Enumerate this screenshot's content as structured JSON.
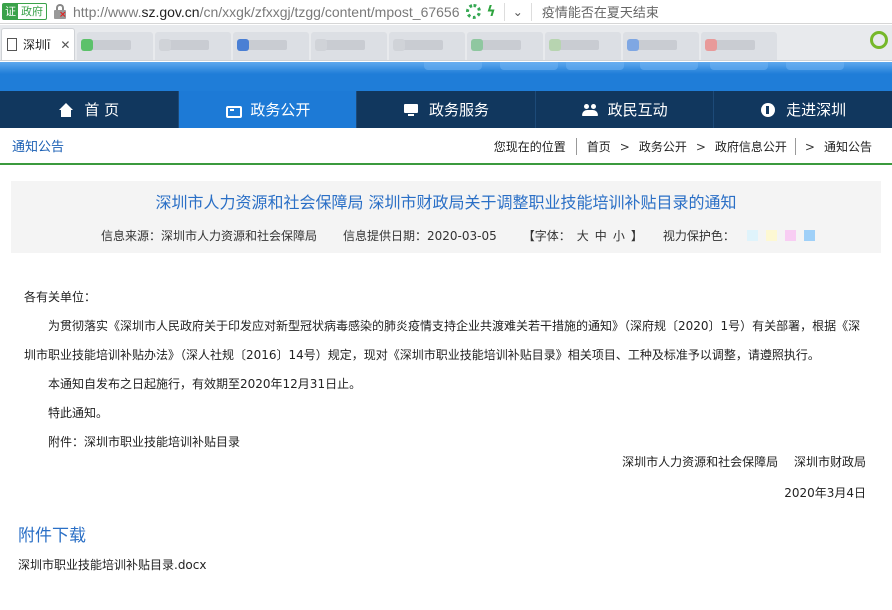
{
  "browser": {
    "cert_badge": "证",
    "cert_label": "政府",
    "url_prefix": "http://www.",
    "url_domain": "sz.gov.cn",
    "url_path": "/cn/xxgk/zfxxgj/tzgg/content/mpost_67656",
    "search_text": "疫情能否在夏天结束",
    "active_tab_label": "深圳ī"
  },
  "nav": {
    "items": [
      {
        "label": "首 页",
        "icon": "home-icon"
      },
      {
        "label": "政务公开",
        "icon": "gov-icon"
      },
      {
        "label": "政务服务",
        "icon": "service-icon"
      },
      {
        "label": "政民互动",
        "icon": "people-icon"
      },
      {
        "label": "走进深圳",
        "icon": "shenzhen-icon"
      }
    ],
    "active": "政务公开"
  },
  "section_title": "通知公告",
  "breadcrumb": {
    "location_label": "您现在的位置",
    "items": [
      "首页",
      "政务公开",
      "政府信息公开",
      "通知公告"
    ]
  },
  "article": {
    "title": "深圳市人力资源和社会保障局 深圳市财政局关于调整职业技能培训补贴目录的通知",
    "source": "信息来源：深圳市人力资源和社会保障局",
    "date_label": "信息提供日期：2020-03-05",
    "font_size_label": "【字体：",
    "font_large": "大",
    "font_medium": "中",
    "font_small": "小",
    "font_close": "】",
    "eye_care_label": "视力保护色：",
    "swatch_colors": [
      "#dff3fb",
      "#fdf8d3",
      "#f8cdf3",
      "#9fd0f8"
    ],
    "salutation": "各有关单位：",
    "para1": "为贯彻落实《深圳市人民政府关于印发应对新型冠状病毒感染的肺炎疫情支持企业共渡难关若干措施的通知》（深府规〔2020〕1号）有关部署，根据《深",
    "para1_cont": "圳市职业技能培训补贴办法》（深人社规〔2016〕14号）规定，现对《深圳市职业技能培训补贴目录》相关项目、工种及标准予以调整，请遵照执行。",
    "para2": "本通知自发布之日起施行，有效期至2020年12月31日止。",
    "para3": "特此通知。",
    "attachment_line": "附件：深圳市职业技能培训补贴目录",
    "signature": "深圳市人力资源和社会保障局　 深圳市财政局",
    "sign_date": "2020年3月4日"
  },
  "attachments": {
    "title": "附件下载",
    "files": [
      "深圳市职业技能培训补贴目录.docx"
    ]
  }
}
